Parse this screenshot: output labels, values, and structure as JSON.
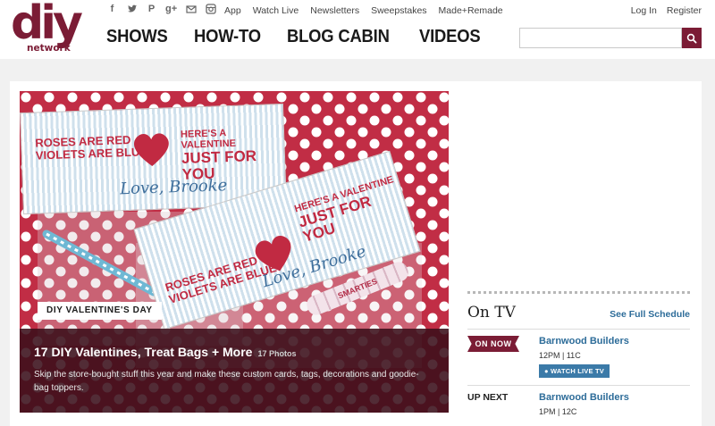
{
  "brand": {
    "logo_word": "diy",
    "logo_sub": "network",
    "accent": "#7b1c35"
  },
  "social": [
    "facebook-icon",
    "twitter-icon",
    "pinterest-icon",
    "google-plus-icon",
    "email-icon",
    "instagram-icon"
  ],
  "util_nav": [
    "App",
    "Watch Live",
    "Newsletters",
    "Sweepstakes",
    "Made+Remade"
  ],
  "auth": {
    "login": "Log In",
    "register": "Register"
  },
  "main_nav": [
    "SHOWS",
    "HOW-TO",
    "BLOG CABIN",
    "VIDEOS"
  ],
  "search": {
    "placeholder": ""
  },
  "hero": {
    "card_line1a": "ROSES ARE RED",
    "card_line1b": "VIOLETS ARE BLUE",
    "card_line2a": "HERE'S A VALENTINE",
    "card_line2b": "JUST FOR YOU",
    "card_sign": "Love, Brooke",
    "candy": "SMARTIES",
    "tag": "DIY VALENTINE'S DAY",
    "title": "17 DIY Valentines, Treat Bags + More",
    "count": "17 Photos",
    "description": "Skip the store-bought stuff this year and make these custom cards, tags, decorations and goodie-bag toppers."
  },
  "on_tv": {
    "title": "On TV",
    "schedule_link": "See Full Schedule",
    "now_label": "ON NOW",
    "now_show": "Barnwood Builders",
    "now_time": "12PM | 11C",
    "watch_label": "WATCH LIVE TV",
    "next_label": "UP NEXT",
    "next_show": "Barnwood Builders",
    "next_time": "1PM | 12C"
  }
}
